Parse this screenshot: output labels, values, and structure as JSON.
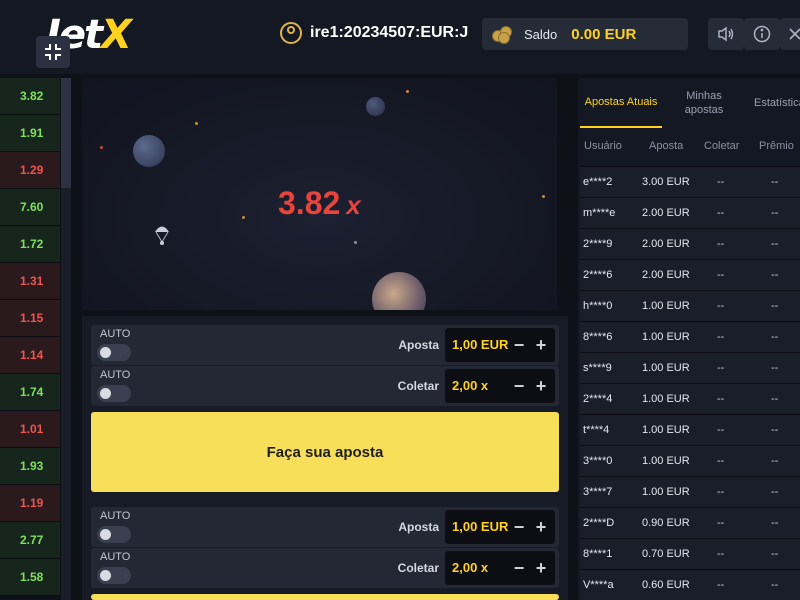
{
  "header": {
    "logo_jet": "Jet",
    "logo_x": "X",
    "username": "ire1:20234507:EUR:J",
    "balance_label": "Saldo",
    "balance_value": "0.00 EUR"
  },
  "history": [
    {
      "value": "3.82",
      "color": "green"
    },
    {
      "value": "1.91",
      "color": "green"
    },
    {
      "value": "1.29",
      "color": "red"
    },
    {
      "value": "7.60",
      "color": "green"
    },
    {
      "value": "1.72",
      "color": "green"
    },
    {
      "value": "1.31",
      "color": "red"
    },
    {
      "value": "1.15",
      "color": "red"
    },
    {
      "value": "1.14",
      "color": "red"
    },
    {
      "value": "1.74",
      "color": "green"
    },
    {
      "value": "1.01",
      "color": "red"
    },
    {
      "value": "1.93",
      "color": "green"
    },
    {
      "value": "1.19",
      "color": "red"
    },
    {
      "value": "2.77",
      "color": "green"
    },
    {
      "value": "1.58",
      "color": "green"
    }
  ],
  "game": {
    "multiplier": "3.82",
    "multiplier_suffix": "x"
  },
  "bet_panel_1": {
    "auto_label": "AUTO",
    "auto_label_2": "AUTO",
    "bet_label": "Aposta",
    "bet_value": "1,00 EUR",
    "collect_label": "Coletar",
    "collect_value": "2,00 x",
    "button_label": "Faça sua aposta"
  },
  "bet_panel_2": {
    "auto_label": "AUTO",
    "auto_label_2": "AUTO",
    "bet_label": "Aposta",
    "bet_value": "1,00 EUR",
    "collect_label": "Coletar",
    "collect_value": "2,00 x"
  },
  "tabs": {
    "current": "Apostas Atuais",
    "mine": "Minhas apostas",
    "stats": "Estatísticas"
  },
  "columns": {
    "user": "Usuário",
    "bet": "Aposta",
    "collect": "Coletar",
    "prize": "Prêmio"
  },
  "bets": [
    {
      "user": "e****2",
      "amount": "3.00 EUR",
      "collect": "--",
      "prize": "--"
    },
    {
      "user": "m****e",
      "amount": "2.00 EUR",
      "collect": "--",
      "prize": "--"
    },
    {
      "user": "2****9",
      "amount": "2.00 EUR",
      "collect": "--",
      "prize": "--"
    },
    {
      "user": "2****6",
      "amount": "2.00 EUR",
      "collect": "--",
      "prize": "--"
    },
    {
      "user": "h****0",
      "amount": "1.00 EUR",
      "collect": "--",
      "prize": "--"
    },
    {
      "user": "8****6",
      "amount": "1.00 EUR",
      "collect": "--",
      "prize": "--"
    },
    {
      "user": "s****9",
      "amount": "1.00 EUR",
      "collect": "--",
      "prize": "--"
    },
    {
      "user": "2****4",
      "amount": "1.00 EUR",
      "collect": "--",
      "prize": "--"
    },
    {
      "user": "t****4",
      "amount": "1.00 EUR",
      "collect": "--",
      "prize": "--"
    },
    {
      "user": "3****0",
      "amount": "1.00 EUR",
      "collect": "--",
      "prize": "--"
    },
    {
      "user": "3****7",
      "amount": "1.00 EUR",
      "collect": "--",
      "prize": "--"
    },
    {
      "user": "2****D",
      "amount": "0.90 EUR",
      "collect": "--",
      "prize": "--"
    },
    {
      "user": "8****1",
      "amount": "0.70 EUR",
      "collect": "--",
      "prize": "--"
    },
    {
      "user": "V****a",
      "amount": "0.60 EUR",
      "collect": "--",
      "prize": "--"
    }
  ],
  "icons": {
    "fullscreen": "fullscreen-icon",
    "user": "user-icon",
    "coins": "coins-icon",
    "sound": "sound-icon",
    "info": "info-icon",
    "close": "close-icon"
  },
  "colors": {
    "accent": "#ffd21e",
    "multiplier": "#e8443c",
    "history_green": "#7fe05d",
    "history_red": "#f0544e",
    "bet_button": "#f8df5a"
  }
}
